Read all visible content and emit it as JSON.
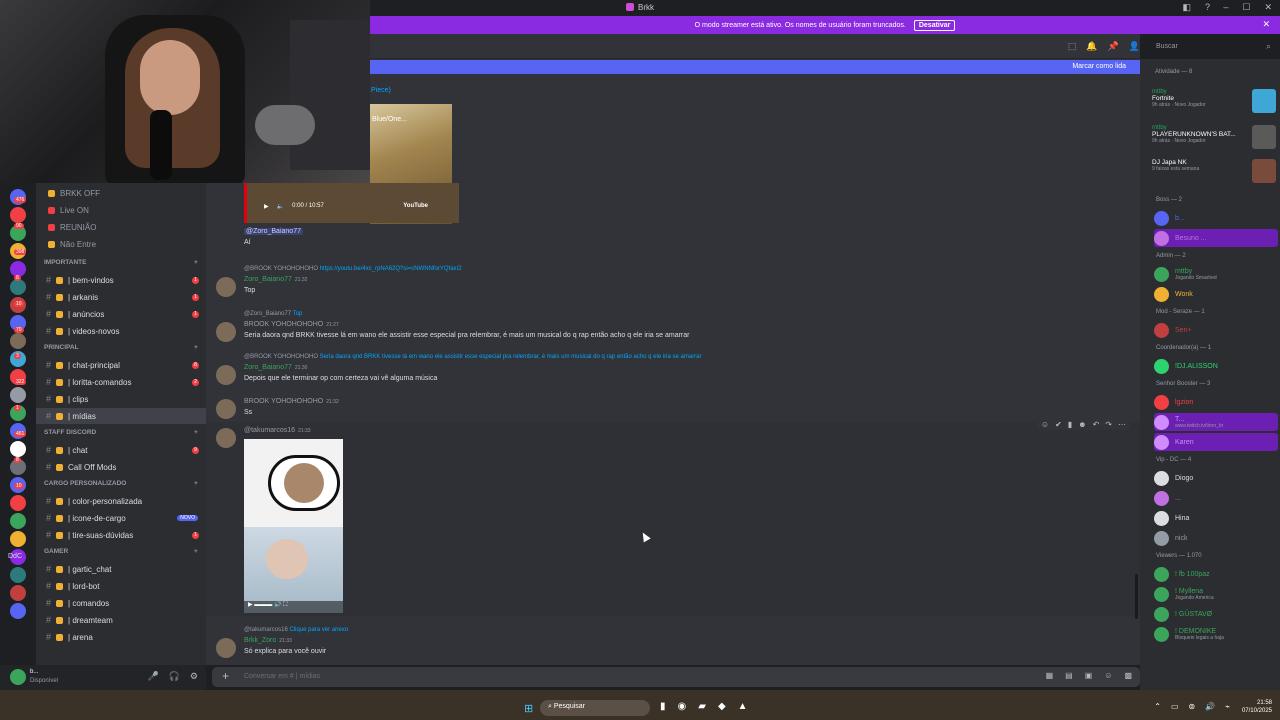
{
  "window": {
    "title": "Brkk",
    "controls": [
      "–",
      "☐",
      "✕"
    ],
    "tb_icons": [
      "◧",
      "?"
    ]
  },
  "streamer": {
    "message": "O modo streamer está ativo. Os nomes de usuário foram truncados.",
    "button": "Desativar",
    "close": "✕"
  },
  "header": {
    "icons": [
      "⬚",
      "🔔",
      "📌",
      "👤"
    ],
    "search_placeholder": "Buscar",
    "search_icon": "⌕"
  },
  "new_messages": {
    "label": "Marcar como lida"
  },
  "servers": {
    "badges": [
      "476",
      "90",
      "398",
      "8",
      "10",
      "70",
      "3",
      "322",
      "1",
      "461",
      "8",
      "10"
    ],
    "label": "DdC"
  },
  "channels": {
    "top": [
      {
        "name": "BRKK OFF",
        "color": "#f0b132"
      },
      {
        "name": "Live ON",
        "color": "#f23f43"
      },
      {
        "name": "REUNIÃO",
        "color": "#f23f43"
      },
      {
        "name": "Não Entre",
        "color": "#f0b132"
      }
    ],
    "categories": [
      {
        "name": "IMPORTANTE",
        "items": [
          {
            "name": "| bem-vindos",
            "badge": "1"
          },
          {
            "name": "| arkanis",
            "badge": "1"
          },
          {
            "name": "| anúncios",
            "badge": "1"
          },
          {
            "name": "| videos-novos",
            "badge": ""
          }
        ]
      },
      {
        "name": "PRINCIPAL",
        "items": [
          {
            "name": "| chat-principal",
            "badge": "8"
          },
          {
            "name": "| loritta-comandos",
            "badge": "2"
          },
          {
            "name": "| clips",
            "badge": ""
          },
          {
            "name": "| mídias",
            "badge": "",
            "active": true
          }
        ]
      },
      {
        "name": "STAFF DISCORD",
        "items": [
          {
            "name": "| chat",
            "badge": "9"
          },
          {
            "name": "Call Off Mods",
            "badge": ""
          }
        ]
      },
      {
        "name": "CARGO PERSONALIZADO",
        "items": [
          {
            "name": "| color-personalizada",
            "badge": ""
          },
          {
            "name": "| icone-de-cargo",
            "badge": "",
            "new": "NOVO"
          },
          {
            "name": "| tire-suas-dúvidas",
            "badge": "1"
          }
        ]
      },
      {
        "name": "GAMER",
        "items": [
          {
            "name": "| gartic_chat",
            "badge": ""
          },
          {
            "name": "| lord-bot",
            "badge": ""
          },
          {
            "name": "| comandos",
            "badge": ""
          },
          {
            "name": "| dreamteam",
            "badge": ""
          },
          {
            "name": "| arena",
            "badge": ""
          }
        ]
      }
    ]
  },
  "user": {
    "name": "b...",
    "status": "Disponível",
    "controls": [
      "🎤",
      "🎧",
      "⚙"
    ]
  },
  "chat": {
    "snippet": "Piece)",
    "video": {
      "title": "Blue/One...",
      "time": "0:00 / 10:57",
      "provider": "YouTube"
    },
    "mention": "@Zoro_Baiano77",
    "mention_text": "Aí",
    "messages": [
      {
        "reply": "@BROOK YOHOHOHOHO",
        "reply_link": "https://youtu.be/4xc_rpNA62Q?si=cNWNNforYQfaxI2",
        "author": "Zoro_Baiano77",
        "author_color": "#3ba55c",
        "time": "21:32",
        "text": "Top"
      },
      {
        "reply": "@Zoro_Baiano77",
        "reply_link": "Top",
        "author": "BROOK YOHOHOHOHO",
        "author_color": "#949ba4",
        "time": "21:27",
        "text": "Seria daora qnd BRKK tivesse lá em wano ele assistir esse especial pra relembrar, é mais um musical do q rap então acho q ele iria se amarrar"
      },
      {
        "reply": "@BROOK YOHOHOHOHO",
        "reply_link": "Seria daora qnd BRKK tivesse lá em wano ele assistir esse especial pra relembrar, é mais um musical do q rap então acho q ele iria se amarrar",
        "author": "Zoro_Baiano77",
        "author_color": "#3ba55c",
        "time": "21:30",
        "text": "Depois que ele terminar op com certeza vai vê alguma música"
      },
      {
        "reply": "",
        "reply_link": "",
        "author": "BROOK YOHOHOHOHO",
        "author_color": "#949ba4",
        "time": "21:32",
        "text": "Ss"
      },
      {
        "reply": "",
        "reply_link": "",
        "author": "@takumarcos16",
        "author_color": "#949ba4",
        "time": "21:33",
        "text": ""
      },
      {
        "reply": "@takumarcos16",
        "reply_link": "Clique para ver anexo",
        "author": "Brkk_Zoro",
        "author_color": "#3ba55c",
        "time": "21:33",
        "text": "Só explica para você ouvir"
      }
    ],
    "hover_actions": [
      "☺",
      "✔",
      "▮",
      "☻",
      "↶",
      "↷",
      "⋯"
    ],
    "composer_placeholder": "Conversar em # | mídias",
    "composer_tools": [
      "▦",
      "▤",
      "▣",
      "☺",
      "▩"
    ]
  },
  "activity": {
    "title": "Atividade — 8",
    "cards": [
      {
        "who": "mttby",
        "game": "Fortnite",
        "sub": "9h atrás · Novo Jogador",
        "art_color": "#3fa7d6"
      },
      {
        "who": "mttby",
        "game": "PLAYERUNKNOWN'S BAT...",
        "sub": "9h atrás · Novo Jogador",
        "art_color": "#5a5a5a"
      },
      {
        "who": "",
        "game": "DJ Japa NK",
        "sub": "9 faixas esta semana",
        "art_color": "#7a4a3a"
      }
    ],
    "groups": [
      {
        "name": "Boss — 2",
        "members": [
          {
            "name": "b...",
            "status": "",
            "hl": false,
            "color": "#5865f2"
          },
          {
            "name": "Besuno ...",
            "status": "",
            "hl": true,
            "color": "#c070e0"
          }
        ]
      },
      {
        "name": "Admin — 2",
        "members": [
          {
            "name": "mttby",
            "status": "Jogando Smashed",
            "hl": false,
            "color": "#3ba55c"
          },
          {
            "name": "Wonk",
            "status": "",
            "hl": false,
            "color": "#f0b132"
          }
        ]
      },
      {
        "name": "Mod - Seraze — 1",
        "members": [
          {
            "name": "Seri+",
            "status": "",
            "hl": false,
            "color": "#c04040"
          }
        ]
      },
      {
        "name": "Coordenador(a) — 1",
        "members": [
          {
            "name": "!DJ.ALISSON",
            "status": "",
            "hl": false,
            "color": "#2dd36f"
          }
        ]
      },
      {
        "name": "Senhor Booster — 3",
        "members": [
          {
            "name": "lgzion",
            "status": "",
            "hl": false,
            "color": "#f23f43"
          },
          {
            "name": "T...",
            "status": "www.twitch.tv/tiron_br",
            "hl": true,
            "color": "#d08bff"
          },
          {
            "name": "Karen",
            "status": "",
            "hl": true,
            "color": "#d08bff"
          }
        ]
      },
      {
        "name": "Vip - DC — 4",
        "members": [
          {
            "name": "Diogo",
            "status": "",
            "hl": false,
            "color": "#dbdee1"
          },
          {
            "name": "...",
            "status": "",
            "hl": false,
            "color": "#c070e0"
          },
          {
            "name": "Hina",
            "status": "",
            "hl": false,
            "color": "#dbdee1"
          },
          {
            "name": "nick",
            "status": "",
            "hl": false,
            "color": "#949ba4"
          }
        ]
      },
      {
        "name": "Viewers — 1.070",
        "members": [
          {
            "name": "! fb 100paz",
            "status": "",
            "hl": false,
            "color": "#3ba55c"
          },
          {
            "name": "! Myllena",
            "status": "Jogando America",
            "hl": false,
            "color": "#3ba55c"
          },
          {
            "name": "! GÜSTAVØ",
            "status": "",
            "hl": false,
            "color": "#3ba55c"
          },
          {
            "name": "! DEMONIKE",
            "status": "Bloqueio legais a haja",
            "hl": false,
            "color": "#3ba55c"
          }
        ]
      }
    ]
  },
  "taskbar": {
    "search": "Pesquisar",
    "time": "21:58",
    "date": "07/10/2025",
    "tray": [
      "⌃",
      "▭",
      "⊚",
      "🔊",
      "⌁"
    ],
    "apps": [
      "▮",
      "◉",
      "▰",
      "◆",
      "▲"
    ]
  }
}
